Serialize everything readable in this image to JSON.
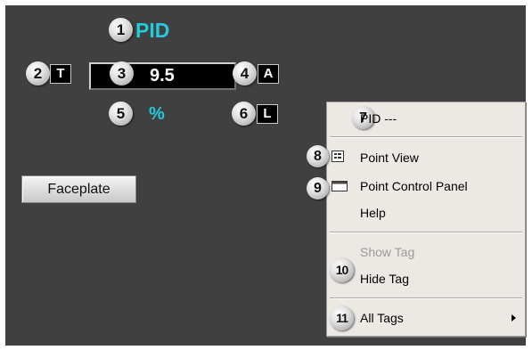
{
  "faceplate": {
    "title": "PID",
    "tag_button": "T",
    "value": "9.5",
    "mode_button": "A",
    "units": "%",
    "local_button": "L",
    "action_button": "Faceplate"
  },
  "callouts": [
    "1",
    "2",
    "3",
    "4",
    "5",
    "6",
    "7",
    "8",
    "9",
    "10",
    "11"
  ],
  "menu": {
    "header": "PID ---",
    "point_view": "Point View",
    "point_control_panel": "Point Control Panel",
    "help": "Help",
    "show_tag": "Show Tag",
    "hide_tag": "Hide Tag",
    "all_tags": "All Tags"
  },
  "colors": {
    "background": "#404040",
    "accent_cyan": "#22ccdd",
    "menu_bg": "#ece9e4",
    "disabled_text": "#9a9a9a"
  },
  "icons": {
    "point_view": "point-view-icon",
    "point_control_panel": "control-panel-icon",
    "submenu": "submenu-arrow-icon"
  }
}
